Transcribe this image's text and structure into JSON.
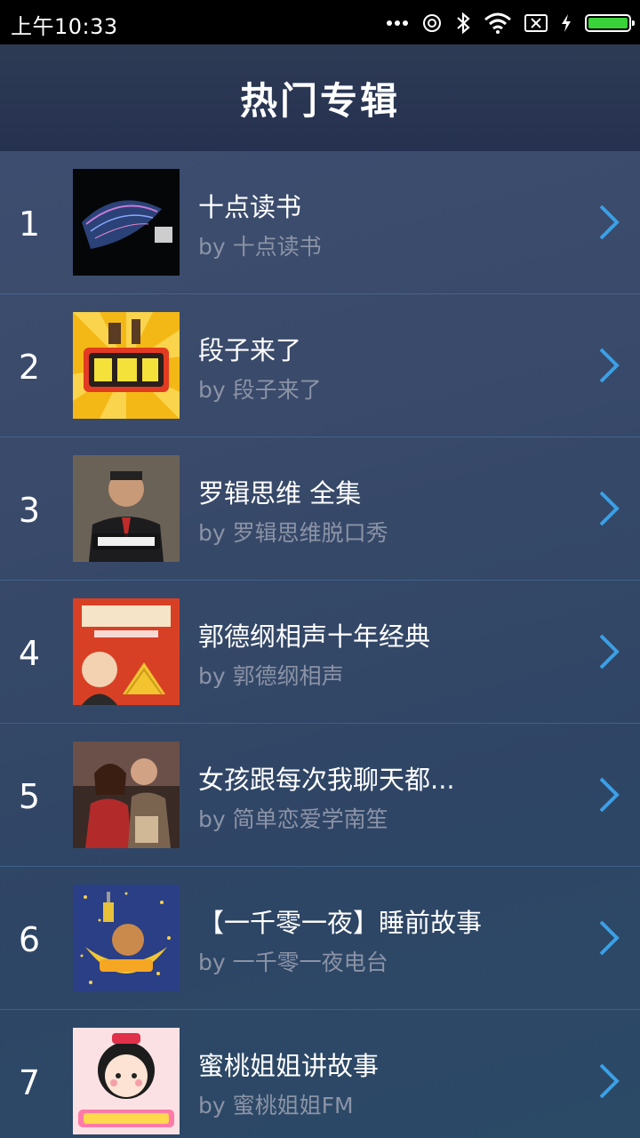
{
  "status_bar": {
    "time": "上午10:33",
    "icons": [
      "more-dots-icon",
      "alarm-icon",
      "bluetooth-icon",
      "wifi-icon",
      "sim-off-icon",
      "charging-icon",
      "battery-icon"
    ],
    "battery_color": "#39d239"
  },
  "header": {
    "title": "热门专辑"
  },
  "albums": [
    {
      "rank": "1",
      "name": "十点读书",
      "author": "by 十点读书"
    },
    {
      "rank": "2",
      "name": "段子来了",
      "author": "by 段子来了"
    },
    {
      "rank": "3",
      "name": "罗辑思维 全集",
      "author": "by 罗辑思维脱口秀"
    },
    {
      "rank": "4",
      "name": "郭德纲相声十年经典",
      "author": "by 郭德纲相声"
    },
    {
      "rank": "5",
      "name": "女孩跟每次我聊天都...",
      "author": "by 简单恋爱学南笙"
    },
    {
      "rank": "6",
      "name": "【一千零一夜】睡前故事",
      "author": "by 一千零一夜电台"
    },
    {
      "rank": "7",
      "name": "蜜桃姐姐讲故事",
      "author": "by 蜜桃姐姐FM"
    }
  ],
  "colors": {
    "accent_chevron": "#3ba0e6",
    "author_text": "#8b93a6"
  }
}
